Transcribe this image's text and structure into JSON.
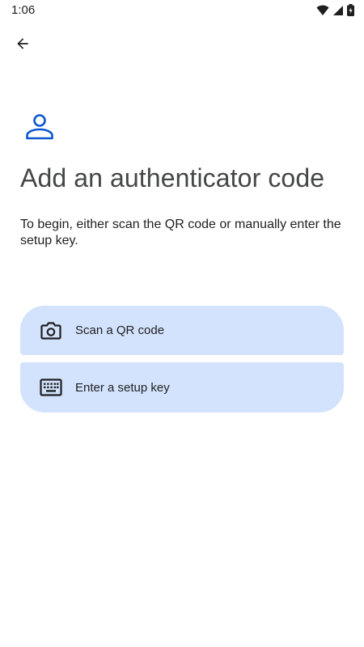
{
  "status_bar": {
    "time": "1:06",
    "icons": [
      "wifi-icon",
      "signal-icon",
      "battery-icon"
    ]
  },
  "header": {
    "back_icon": "arrow-back-icon"
  },
  "main": {
    "icon": "person-icon",
    "title": "Add an authenticator code",
    "description": "To begin, either scan the QR code or manually enter the setup key.",
    "options": [
      {
        "icon": "camera-icon",
        "label": "Scan a QR code"
      },
      {
        "icon": "keyboard-icon",
        "label": "Enter a setup key"
      }
    ]
  },
  "colors": {
    "accent": "#0b57d0",
    "option_background": "#d3e3fd",
    "title_text": "#444746"
  }
}
